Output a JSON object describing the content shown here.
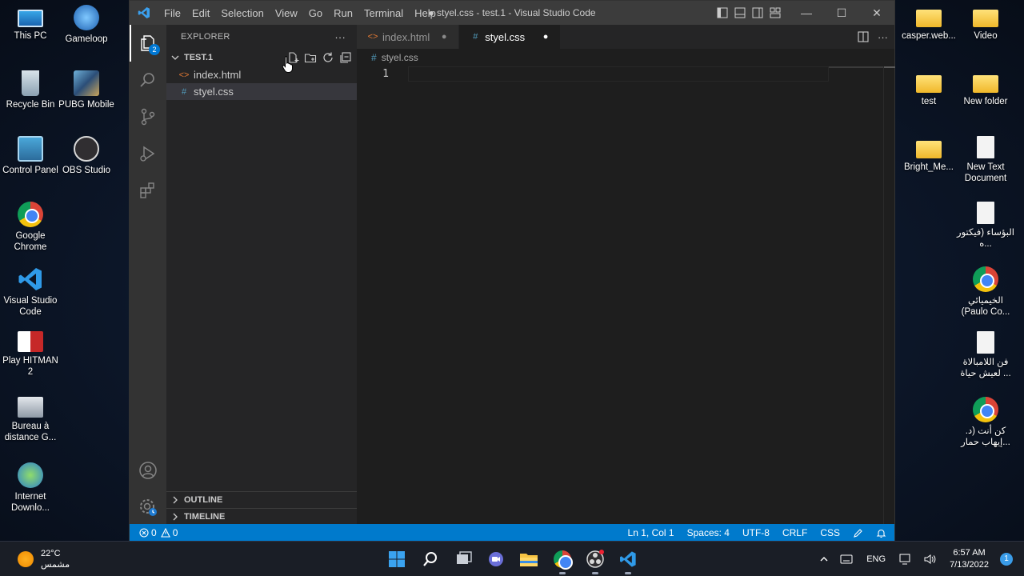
{
  "desktop": {
    "left_icons": [
      {
        "label": "This PC",
        "kind": "pc"
      },
      {
        "label": "Gameloop",
        "kind": "round"
      },
      {
        "label": "Recycle Bin",
        "kind": "bin"
      },
      {
        "label": "PUBG Mobile",
        "kind": "round"
      },
      {
        "label": "Control Panel",
        "kind": "cp"
      },
      {
        "label": "OBS Studio",
        "kind": "round"
      },
      {
        "label": "Google Chrome",
        "kind": "chrome"
      },
      {
        "label": "Visual Studio Code",
        "kind": "vscode"
      },
      {
        "label": "Play HITMAN 2",
        "kind": "hitman"
      },
      {
        "label": "Bureau à distance G...",
        "kind": "rdp"
      },
      {
        "label": "Internet Downlo...",
        "kind": "idm"
      }
    ],
    "right_icons": [
      {
        "label": "casper.web...",
        "kind": "folder"
      },
      {
        "label": "Video",
        "kind": "folder"
      },
      {
        "label": "test",
        "kind": "folder"
      },
      {
        "label": "New folder",
        "kind": "folder"
      },
      {
        "label": "Bright_Me...",
        "kind": "folder"
      },
      {
        "label": "New Text Document",
        "kind": "doc"
      },
      {
        "label": "البؤساء (فيكتور ه...",
        "kind": "doc"
      },
      {
        "label": "الخيميائي (Paulo Co...",
        "kind": "chrome"
      },
      {
        "label": "فن اللامبالاة لعيش حياة ...",
        "kind": "doc"
      },
      {
        "label": "كن أنت (د. إيهاب حمار...",
        "kind": "chrome"
      }
    ]
  },
  "vscode": {
    "menu": [
      "File",
      "Edit",
      "Selection",
      "View",
      "Go",
      "Run",
      "Terminal",
      "Help"
    ],
    "window_title": "● styel.css - test.1 - Visual Studio Code",
    "window_buttons": {
      "minimize": "—",
      "maximize": "☐",
      "close": "✕"
    },
    "activity": {
      "explorer_badge": "2"
    },
    "explorer": {
      "header": "EXPLORER",
      "more": "···",
      "folder": "TEST.1",
      "files": [
        {
          "name": "index.html",
          "icon": "<>",
          "type": "html",
          "selected": false
        },
        {
          "name": "styel.css",
          "icon": "#",
          "type": "css",
          "selected": true
        }
      ],
      "outline": "OUTLINE",
      "timeline": "TIMELINE"
    },
    "tabs": [
      {
        "name": "index.html",
        "icon": "<>",
        "type": "html",
        "active": false,
        "dirty_mark": "●"
      },
      {
        "name": "styel.css",
        "icon": "#",
        "type": "css",
        "active": true,
        "dirty_mark": "●"
      }
    ],
    "breadcrumb": {
      "icon": "#",
      "file": "styel.css"
    },
    "editor": {
      "line_number": "1"
    },
    "statusbar": {
      "errors": "0",
      "warnings": "0",
      "position": "Ln 1, Col 1",
      "spaces": "Spaces: 4",
      "encoding": "UTF-8",
      "eol": "CRLF",
      "language": "CSS"
    },
    "colors": {
      "statusbar": "#007acc",
      "activitybar": "#333333",
      "sidebar": "#252526",
      "editor": "#1e1e1e"
    }
  },
  "taskbar": {
    "weather_temp": "22°C",
    "weather_desc": "مشمس",
    "language": "ENG",
    "time": "6:57 AM",
    "date": "7/13/2022",
    "notifications": "1"
  }
}
